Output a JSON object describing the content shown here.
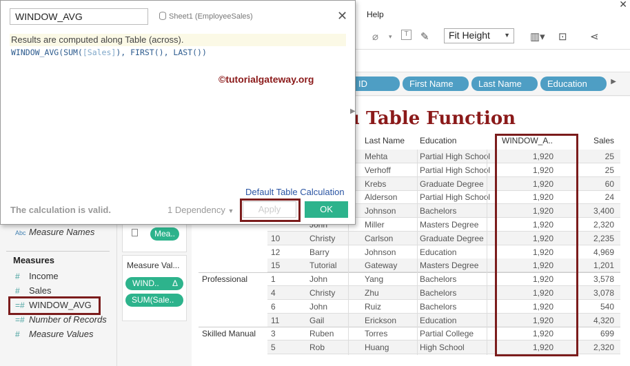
{
  "menu": {
    "help": "Help"
  },
  "toolbar": {
    "fit": "Fit Height"
  },
  "pills": [
    "ID",
    "First Name",
    "Last Name",
    "Education"
  ],
  "sheet_title": "u Table Function",
  "table": {
    "headers": [
      "Last Name",
      "Education",
      "WINDOW_A..",
      "Sales"
    ],
    "rows": [
      {
        "group": "",
        "id": "",
        "first": "",
        "last": "Mehta",
        "edu": "Partial High School",
        "wa": "1,920",
        "sales": "25"
      },
      {
        "group": "",
        "id": "",
        "first": "",
        "last": "Verhoff",
        "edu": "Partial High School",
        "wa": "1,920",
        "sales": "25"
      },
      {
        "group": "",
        "id": "",
        "first": "",
        "last": "Krebs",
        "edu": "Graduate Degree",
        "wa": "1,920",
        "sales": "60"
      },
      {
        "group": "",
        "id": "",
        "first": "",
        "last": "Alderson",
        "edu": "Partial High School",
        "wa": "1,920",
        "sales": "24"
      },
      {
        "group": "",
        "id": "",
        "first": "",
        "last": "Johnson",
        "edu": "Bachelors",
        "wa": "1,920",
        "sales": "3,400"
      },
      {
        "group": "",
        "id": "",
        "first": "John",
        "last": "Miller",
        "edu": "Masters Degree",
        "wa": "1,920",
        "sales": "2,320"
      },
      {
        "group": "",
        "id": "10",
        "first": "Christy",
        "last": "Carlson",
        "edu": "Graduate Degree",
        "wa": "1,920",
        "sales": "2,235"
      },
      {
        "group": "",
        "id": "12",
        "first": "Barry",
        "last": "Johnson",
        "edu": "Education",
        "wa": "1,920",
        "sales": "4,969"
      },
      {
        "group": "",
        "id": "15",
        "first": "Tutorial",
        "last": "Gateway",
        "edu": "Masters Degree",
        "wa": "1,920",
        "sales": "1,201"
      },
      {
        "group": "Professional",
        "id": "1",
        "first": "John",
        "last": "Yang",
        "edu": "Bachelors",
        "wa": "1,920",
        "sales": "3,578"
      },
      {
        "group": "",
        "id": "4",
        "first": "Christy",
        "last": "Zhu",
        "edu": "Bachelors",
        "wa": "1,920",
        "sales": "3,078"
      },
      {
        "group": "",
        "id": "6",
        "first": "John",
        "last": "Ruiz",
        "edu": "Bachelors",
        "wa": "1,920",
        "sales": "540"
      },
      {
        "group": "",
        "id": "11",
        "first": "Gail",
        "last": "Erickson",
        "edu": "Education",
        "wa": "1,920",
        "sales": "4,320"
      },
      {
        "group": "Skilled Manual",
        "id": "3",
        "first": "Ruben",
        "last": "Torres",
        "edu": "Partial College",
        "wa": "1,920",
        "sales": "699"
      },
      {
        "group": "",
        "id": "5",
        "first": "Rob",
        "last": "Huang",
        "edu": "High School",
        "wa": "1,920",
        "sales": "2,320"
      }
    ]
  },
  "left_panel": {
    "measure_names": "Measure Names",
    "measures_header": "Measures",
    "measures": [
      {
        "icon": "#",
        "label": "Income",
        "italic": false
      },
      {
        "icon": "#",
        "label": "Sales",
        "italic": false
      },
      {
        "icon": "=#",
        "label": "WINDOW_AVG",
        "italic": false
      },
      {
        "icon": "=#",
        "label": "Number of Records",
        "italic": true
      },
      {
        "icon": "#",
        "label": "Measure Values",
        "italic": true
      }
    ],
    "abc": "Abc"
  },
  "cards": {
    "mea_pill": "Mea..",
    "measure_values_title": "Measure Val...",
    "window_pill": "WIND..",
    "delta": "Δ",
    "sum_pill": "SUM(Sale.."
  },
  "dialog": {
    "name": "WINDOW_AVG",
    "source": "Sheet1 (EmployeeSales)",
    "hint": "Results are computed along Table (across).",
    "formula_fn": "WINDOW_AVG(SUM(",
    "formula_field": "[Sales]",
    "formula_rest": "), FIRST(), LAST())",
    "watermark": "©tutorialgateway.org",
    "default_calc": "Default Table Calculation",
    "valid": "The calculation is valid.",
    "dependency": "1 Dependency",
    "apply": "Apply",
    "ok": "OK"
  },
  "colors": {
    "accent_green": "#2db38c",
    "pill_blue": "#4e9ec4",
    "highlight": "#7b1c1c",
    "title_red": "#8b1a1a"
  }
}
